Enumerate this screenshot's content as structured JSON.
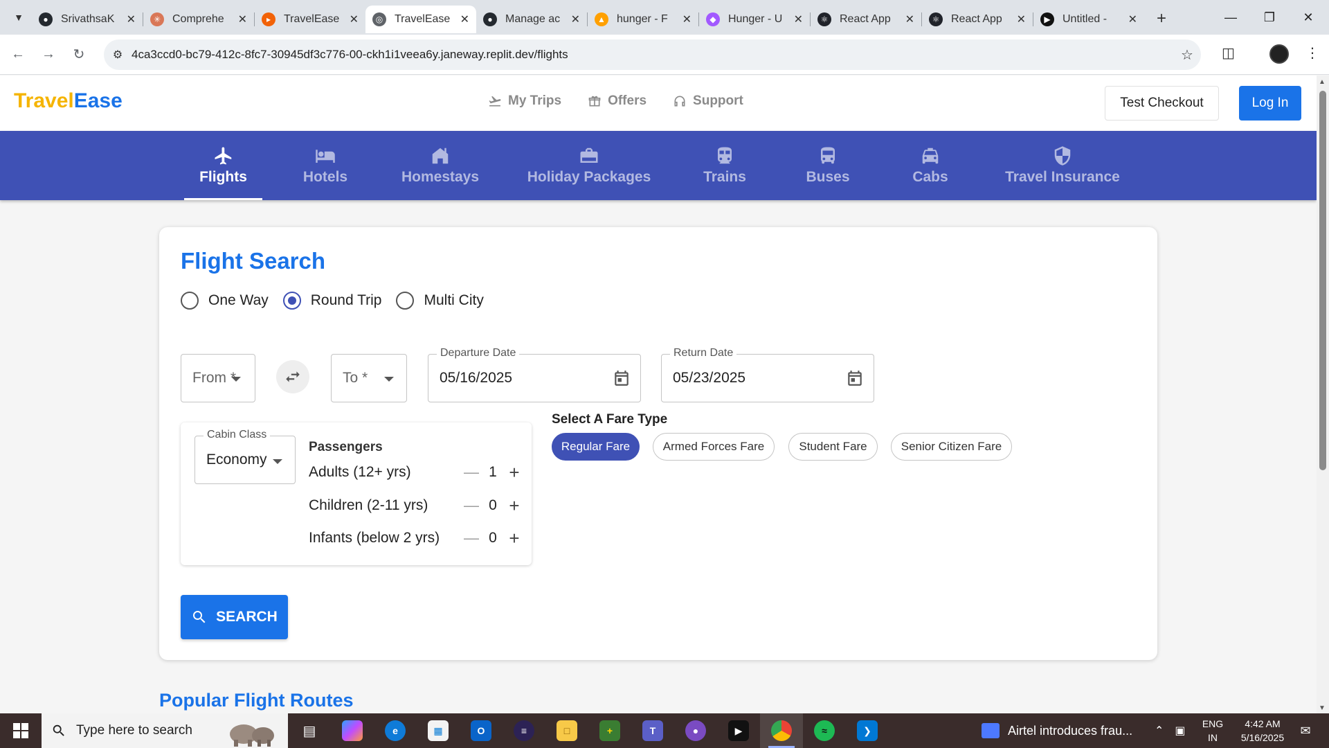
{
  "browser": {
    "tabs": [
      {
        "title": "SrivathsaK",
        "icon": "github-icon",
        "color": "#24292f"
      },
      {
        "title": "Comprehe",
        "icon": "claude-icon",
        "color": "#d97757"
      },
      {
        "title": "TravelEase",
        "icon": "replit-icon",
        "color": "#f26207"
      },
      {
        "title": "TravelEase",
        "icon": "globe-icon",
        "color": "#5f6368",
        "active": true
      },
      {
        "title": "Manage ac",
        "icon": "github-icon",
        "color": "#24292f"
      },
      {
        "title": "hunger - F",
        "icon": "firebase-icon",
        "color": "#ffa000"
      },
      {
        "title": "Hunger - U",
        "icon": "figma-icon",
        "color": "#a259ff"
      },
      {
        "title": "React App",
        "icon": "react-icon",
        "color": "#20232a"
      },
      {
        "title": "React App",
        "icon": "react-icon",
        "color": "#20232a"
      },
      {
        "title": "Untitled - ",
        "icon": "play-icon",
        "color": "#111111"
      }
    ],
    "url": "4ca3ccd0-bc79-412c-8fc7-30945df3c776-00-ckh1i1veea6y.janeway.replit.dev/flights"
  },
  "header": {
    "logo_part1": "Travel",
    "logo_part2": "Ease",
    "nav": [
      {
        "label": "My Trips",
        "icon": "flight-takeoff-icon"
      },
      {
        "label": "Offers",
        "icon": "gift-icon"
      },
      {
        "label": "Support",
        "icon": "headset-icon"
      }
    ],
    "checkout_label": "Test Checkout",
    "login_label": "Log In"
  },
  "categories": [
    {
      "label": "Flights",
      "icon": "airplane-icon",
      "active": true
    },
    {
      "label": "Hotels",
      "icon": "hotel-bed-icon"
    },
    {
      "label": "Homestays",
      "icon": "house-icon"
    },
    {
      "label": "Holiday Packages",
      "icon": "suitcase-icon"
    },
    {
      "label": "Trains",
      "icon": "train-icon"
    },
    {
      "label": "Buses",
      "icon": "bus-icon"
    },
    {
      "label": "Cabs",
      "icon": "taxi-icon"
    },
    {
      "label": "Travel Insurance",
      "icon": "shield-icon"
    }
  ],
  "search": {
    "title": "Flight Search",
    "trip_types": [
      {
        "label": "One Way",
        "selected": false
      },
      {
        "label": "Round Trip",
        "selected": true
      },
      {
        "label": "Multi City",
        "selected": false
      }
    ],
    "from_placeholder": "From *",
    "to_placeholder": "To *",
    "departure_label": "Departure Date",
    "departure_value": "05/16/2025",
    "return_label": "Return Date",
    "return_value": "05/23/2025",
    "cabin_label": "Cabin Class",
    "cabin_value": "Economy",
    "passengers_title": "Passengers",
    "passengers": [
      {
        "label": "Adults (12+ yrs)",
        "count": "1"
      },
      {
        "label": "Children (2-11 yrs)",
        "count": "0"
      },
      {
        "label": "Infants (below 2 yrs)",
        "count": "0"
      }
    ],
    "fare_title": "Select A Fare Type",
    "fares": [
      {
        "label": "Regular Fare",
        "selected": true
      },
      {
        "label": "Armed Forces Fare",
        "selected": false
      },
      {
        "label": "Student Fare",
        "selected": false
      },
      {
        "label": "Senior Citizen Fare",
        "selected": false
      }
    ],
    "search_label": "SEARCH"
  },
  "popular_title": "Popular Flight Routes",
  "taskbar": {
    "search_placeholder": "Type here to search",
    "news": "Airtel introduces frau...",
    "lang_line1": "ENG",
    "lang_line2": "IN",
    "time": "4:42 AM",
    "date": "5/16/2025"
  },
  "colors": {
    "brand_blue": "#1a73e8",
    "indigo": "#3f51b5",
    "logo_yellow": "#f5b400"
  }
}
